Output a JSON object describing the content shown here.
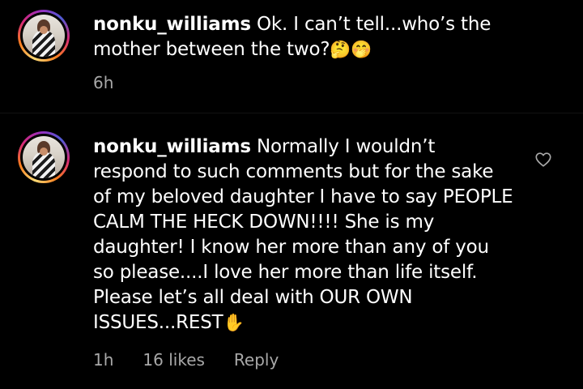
{
  "comments": [
    {
      "username": "nonku_williams",
      "text": "Ok. I can’t tell...who’s the mother between the two?",
      "emojis": "🤔🤭",
      "time": "6h"
    },
    {
      "username": "nonku_williams",
      "text": "Normally I wouldn’t respond to such comments but for the sake of my beloved daughter I have to say PEOPLE CALM THE HECK DOWN!!!! She is my daughter! I know her more than any of you so please....I love her more than life itself. Please let’s all deal with OUR OWN ISSUES...REST",
      "emojis": "✋",
      "time": "1h",
      "likes": "16 likes",
      "reply_label": "Reply"
    }
  ],
  "colors": {
    "background": "#000000",
    "text": "#ffffff",
    "meta": "#a8a8a8"
  },
  "icons": {
    "like": "heart-outline-icon"
  }
}
